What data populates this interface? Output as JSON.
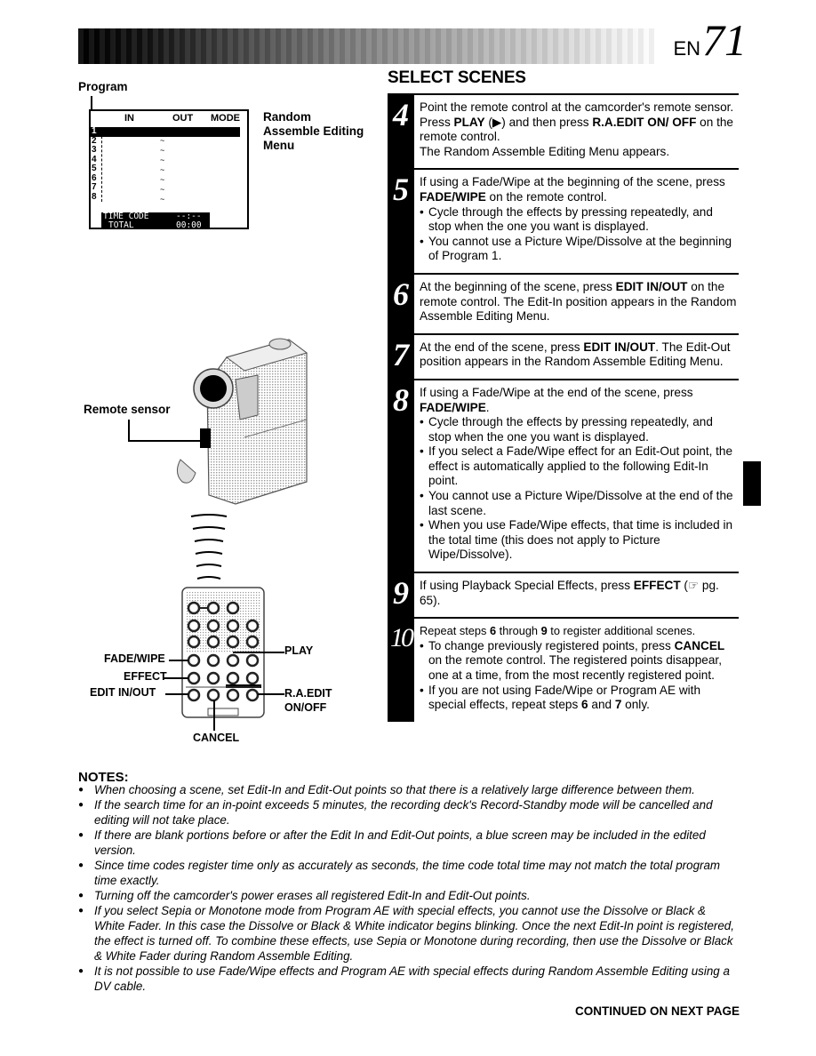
{
  "header": {
    "lang_label": "EN",
    "page_number": "71"
  },
  "left": {
    "program_label": "Program",
    "menu": {
      "col_in": "IN",
      "col_out": "OUT",
      "col_mode": "MODE",
      "rows": [
        "1",
        "2",
        "3",
        "4",
        "5",
        "6",
        "7",
        "8"
      ],
      "time_code_label": "TIME CODE",
      "time_code_value": "--:--",
      "total_label": "TOTAL",
      "total_value": "00:00"
    },
    "menu_caption": [
      "Random",
      "Assemble Editing",
      "Menu"
    ],
    "remote_sensor_label": "Remote sensor",
    "remote_labels": {
      "fade_wipe": "FADE/WIPE",
      "effect": "EFFECT",
      "edit_in_out": "EDIT IN/OUT",
      "play": "PLAY",
      "ra_edit_1": "R.A.EDIT",
      "ra_edit_2": "ON/OFF",
      "cancel": "CANCEL"
    }
  },
  "right": {
    "section_title": "SELECT SCENES",
    "steps": [
      {
        "number": "4",
        "parts": [
          {
            "t": "Point the remote control at the camcorder's remote sensor. Press "
          },
          {
            "b": "PLAY"
          },
          {
            "t": " (▶) and then press "
          },
          {
            "b": "R.A.EDIT ON/ OFF"
          },
          {
            "t": " on the remote control."
          }
        ],
        "line2": "The Random Assemble Editing Menu appears.",
        "bullets": []
      },
      {
        "number": "5",
        "parts": [
          {
            "t": "If using a Fade/Wipe at the beginning of the scene, press "
          },
          {
            "b": "FADE/WIPE"
          },
          {
            "t": " on the remote control."
          }
        ],
        "bullets": [
          "Cycle through the effects by pressing repeatedly, and stop when the one you want is displayed.",
          "You cannot use a Picture Wipe/Dissolve at the beginning of Program 1."
        ]
      },
      {
        "number": "6",
        "parts": [
          {
            "t": "At the beginning of the scene, press "
          },
          {
            "b": "EDIT IN/OUT"
          },
          {
            "t": " on the remote control. The Edit-In position appears in the Random Assemble Editing Menu."
          }
        ],
        "bullets": []
      },
      {
        "number": "7",
        "parts": [
          {
            "t": "At the end of the scene, press "
          },
          {
            "b": "EDIT IN/OUT"
          },
          {
            "t": ". The Edit-Out position appears in the Random Assemble Editing Menu."
          }
        ],
        "bullets": []
      },
      {
        "number": "8",
        "parts": [
          {
            "t": "If using a Fade/Wipe at the end of the scene, press "
          },
          {
            "b": "FADE/WIPE"
          },
          {
            "t": "."
          }
        ],
        "bullets": [
          "Cycle through the effects by pressing repeatedly, and stop when the one you want is displayed.",
          "If you select a Fade/Wipe effect for an Edit-Out point, the effect is automatically applied to the following Edit-In point.",
          "You cannot use a Picture Wipe/Dissolve at the end of the last scene.",
          "When you use Fade/Wipe effects, that time is included in the total time (this does not apply to Picture Wipe/Dissolve)."
        ]
      },
      {
        "number": "9",
        "parts": [
          {
            "t": "If using Playback Special Effects, press "
          },
          {
            "b": "EFFECT"
          },
          {
            "t": " (☞ pg. 65)."
          }
        ],
        "bullets": []
      },
      {
        "number": "10",
        "parts": [
          {
            "t": "Repeat steps "
          },
          {
            "b": "6"
          },
          {
            "t": " through "
          },
          {
            "b": "9"
          },
          {
            "t": " to register additional scenes."
          }
        ],
        "bullets_rich": [
          [
            {
              "t": "To change previously registered points, press "
            },
            {
              "b": "CANCEL"
            },
            {
              "t": " on the remote control. The registered points disappear, one at a time, from the most recently registered point."
            }
          ],
          [
            {
              "t": "If you are not using Fade/Wipe or Program AE with special effects, repeat steps "
            },
            {
              "b": "6"
            },
            {
              "t": " and "
            },
            {
              "b": "7"
            },
            {
              "t": " only."
            }
          ]
        ]
      }
    ]
  },
  "notes": {
    "title": "NOTES:",
    "items": [
      "When choosing a scene, set Edit-In and Edit-Out points so that there is a relatively large difference between them.",
      "If the search time for an in-point exceeds 5 minutes, the recording deck's Record-Standby mode will be cancelled and editing will not take place.",
      "If there are blank portions before or after the Edit In and Edit-Out points, a blue screen may be included in the edited version.",
      "Since time codes register time only as accurately as seconds, the time code total time may not match the total program time exactly.",
      "Turning off the camcorder's power erases all registered Edit-In and Edit-Out points.",
      "If you select Sepia or Monotone mode from Program AE with special effects, you cannot use the Dissolve or Black & White Fader. In this case the Dissolve or Black & White indicator begins blinking. Once the next Edit-In point is registered, the effect is turned off. To combine these effects, use Sepia or Monotone during recording, then use the Dissolve or Black & White Fader during Random Assemble Editing.",
      "It is not possible to use Fade/Wipe effects and Program AE with special effects during Random Assemble Editing using a DV cable."
    ],
    "continued": "CONTINUED ON NEXT PAGE"
  }
}
